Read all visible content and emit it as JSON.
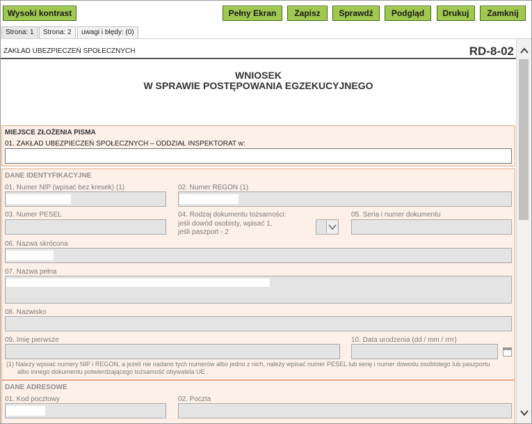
{
  "toolbar": {
    "high_contrast": "Wysoki kontrast",
    "fullscreen": "Pełny Ekran",
    "save": "Zapisz",
    "check": "Sprawdź",
    "preview": "Podgląd",
    "print": "Drukuj",
    "close": "Zamknij"
  },
  "tabs": [
    "Strona: 1",
    "Strona: 2",
    "uwagi i błędy: (0)"
  ],
  "header": {
    "institution": "ZAKŁAD UBEZPIECZEŃ SPOŁECZNYCH",
    "form_code": "RD-8-02",
    "title_line1": "WNIOSEK",
    "title_line2": "W SPRAWIE POSTĘPOWANIA EGZEKUCYJNEGO"
  },
  "section_place": {
    "title": "MIEJSCE ZŁOŻENIA PISMA",
    "field01_label": "01. ZAKŁAD UBEZPIECZEŃ SPOŁECZNYCH – ODDZIAŁ INSPEKTORAT w:",
    "field01_value": ""
  },
  "section_ident": {
    "title": "DANE IDENTYFIKACYJNE",
    "nip_label": "01. Numer NIP (wpisać bez kresek) (1)",
    "regon_label": "02. Numer REGON (1)",
    "pesel_label": "03. Numer PESEL",
    "doc_type_label": "04. Rodzaj dokumentu tożsamości:",
    "doc_type_hint1": "jeśli dowód osobisty, wpisać 1,",
    "doc_type_hint2": "jeśli paszport - 2",
    "doc_series_label": "05. Seria i numer dokumentu",
    "short_name_label": "06. Nazwa skrócona",
    "full_name_label": "07. Nazwa pełna",
    "surname_label": "08. Nazwisko",
    "first_name_label": "09. Imię pierwsze",
    "birth_date_label": "10. Data urodzenia (dd / mm / rrrr)",
    "note_line1": "(1)  Należy wpisać numery NIP i REGON, a jeżeli nie nadano tych numerów albo jedno z nich, należy wpisać numer PESEL lub serię i numer dowodu osobistego lub paszportu",
    "note_line2": "albo innego dokumentu potwierdzającego tożsamość obywatela UE ."
  },
  "section_address": {
    "title": "DANE ADRESOWE",
    "postcode_label": "01. Kod pocztowy",
    "post_office_label": "02. Poczta"
  },
  "icons": {
    "dropdown": "chevron-down-icon",
    "calendar": "calendar-icon",
    "scroll_up": "scroll-up-icon",
    "scroll_down": "scroll-down-icon"
  },
  "colors": {
    "button_bg": "#a0c850",
    "section_bg": "#fdf0e8",
    "section_border": "#e6a882"
  }
}
